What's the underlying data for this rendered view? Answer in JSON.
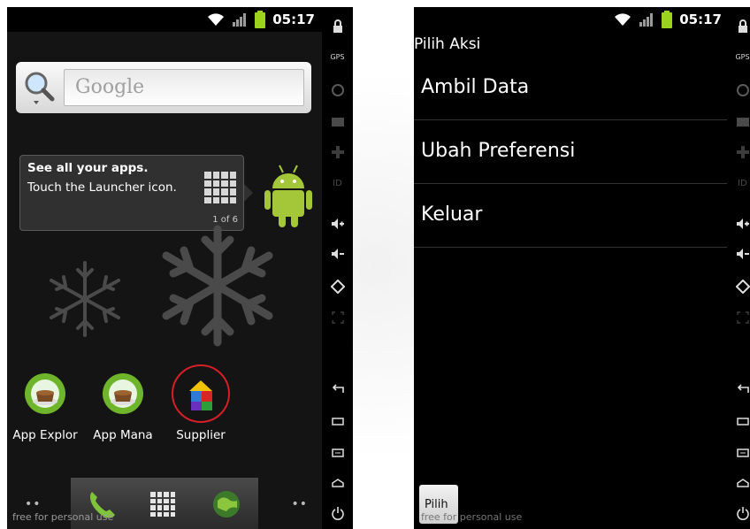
{
  "left_phone": {
    "status": {
      "time": "05:17"
    },
    "search": {
      "placeholder": "Google"
    },
    "tooltip": {
      "title": "See all your apps.",
      "text": "Touch the Launcher icon.",
      "page": "1 of 6"
    },
    "apps": [
      {
        "label": "App Explor",
        "icon": "app-explorer-icon"
      },
      {
        "label": "App Mana",
        "icon": "app-manager-icon"
      },
      {
        "label": "Supplier",
        "icon": "supplier-icon"
      }
    ],
    "dock": {
      "dots_left": "••",
      "dots_right": "••"
    },
    "watermark": "free for personal use",
    "highlight_color": "#d61f26"
  },
  "sidebar": {
    "items": [
      "lock-icon",
      "gps-icon",
      "camera-icon",
      "film-icon",
      "dpad-icon",
      "id-icon",
      "volume-up-icon",
      "volume-down-icon",
      "rotate-icon",
      "fullscreen-icon",
      "back-icon",
      "recent-icon",
      "menu-icon",
      "home-icon",
      "power-icon"
    ],
    "gps_label": "GPS",
    "id_label": "ID"
  },
  "right_phone": {
    "status": {
      "time": "05:17"
    },
    "title": "Pilih Aksi",
    "menu": [
      {
        "label": "Ambil Data"
      },
      {
        "label": "Ubah Preferensi"
      },
      {
        "label": "Keluar"
      }
    ],
    "button_label": "Pilih",
    "watermark": "free for personal use"
  }
}
